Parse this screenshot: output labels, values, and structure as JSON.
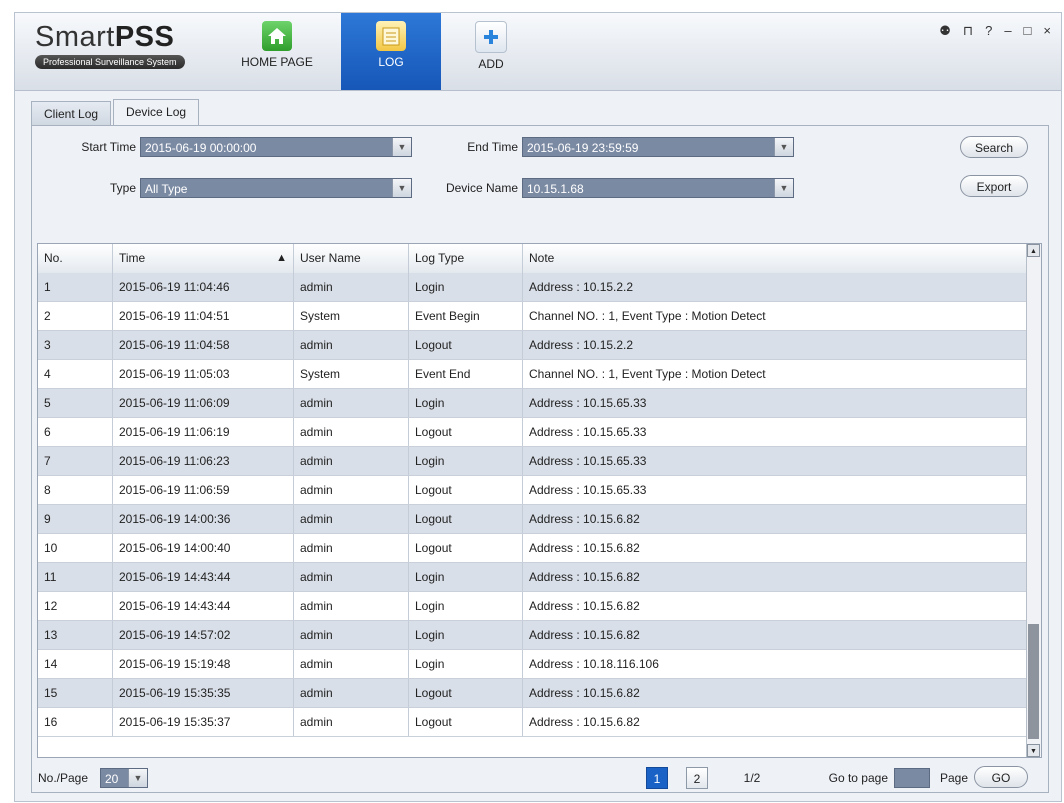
{
  "app": {
    "title_light": "Smart",
    "title_bold": "PSS",
    "subtitle": "Professional Surveillance System"
  },
  "nav": {
    "home": "HOME PAGE",
    "log": "LOG",
    "add": "ADD"
  },
  "window_controls": {
    "user": "⚉",
    "lock": "⊓",
    "help": "?",
    "minimize": "–",
    "maximize": "□",
    "close": "×"
  },
  "tabs": [
    "Client Log",
    "Device Log"
  ],
  "filters": {
    "start_label": "Start Time",
    "start_value": "2015-06-19 00:00:00",
    "end_label": "End Time",
    "end_value": "2015-06-19 23:59:59",
    "type_label": "Type",
    "type_value": "All Type",
    "device_label": "Device Name",
    "device_value": "10.15.1.68",
    "search": "Search",
    "export": "Export"
  },
  "table": {
    "headers": [
      "No.",
      "Time",
      "User Name",
      "Log Type",
      "Note"
    ],
    "rows": [
      [
        "1",
        "2015-06-19 11:04:46",
        "admin",
        "Login",
        "Address : 10.15.2.2"
      ],
      [
        "2",
        "2015-06-19 11:04:51",
        "System",
        "Event Begin",
        "Channel NO. : 1, Event Type : Motion Detect"
      ],
      [
        "3",
        "2015-06-19 11:04:58",
        "admin",
        "Logout",
        "Address : 10.15.2.2"
      ],
      [
        "4",
        "2015-06-19 11:05:03",
        "System",
        "Event End",
        "Channel NO. : 1, Event Type : Motion Detect"
      ],
      [
        "5",
        "2015-06-19 11:06:09",
        "admin",
        "Login",
        "Address : 10.15.65.33"
      ],
      [
        "6",
        "2015-06-19 11:06:19",
        "admin",
        "Logout",
        "Address : 10.15.65.33"
      ],
      [
        "7",
        "2015-06-19 11:06:23",
        "admin",
        "Login",
        "Address : 10.15.65.33"
      ],
      [
        "8",
        "2015-06-19 11:06:59",
        "admin",
        "Logout",
        "Address : 10.15.65.33"
      ],
      [
        "9",
        "2015-06-19 14:00:36",
        "admin",
        "Logout",
        "Address : 10.15.6.82"
      ],
      [
        "10",
        "2015-06-19 14:00:40",
        "admin",
        "Logout",
        "Address : 10.15.6.82"
      ],
      [
        "11",
        "2015-06-19 14:43:44",
        "admin",
        "Login",
        "Address : 10.15.6.82"
      ],
      [
        "12",
        "2015-06-19 14:43:44",
        "admin",
        "Login",
        "Address : 10.15.6.82"
      ],
      [
        "13",
        "2015-06-19 14:57:02",
        "admin",
        "Login",
        "Address : 10.15.6.82"
      ],
      [
        "14",
        "2015-06-19 15:19:48",
        "admin",
        "Login",
        "Address : 10.18.116.106"
      ],
      [
        "15",
        "2015-06-19 15:35:35",
        "admin",
        "Logout",
        "Address : 10.15.6.82"
      ],
      [
        "16",
        "2015-06-19 15:35:37",
        "admin",
        "Logout",
        "Address : 10.15.6.82"
      ]
    ]
  },
  "footer": {
    "per_page_label": "No./Page",
    "per_page_value": "20",
    "page1": "1",
    "page2": "2",
    "page_count": "1/2",
    "goto_label": "Go to page",
    "goto_value": "",
    "page_label": "Page",
    "go": "GO"
  },
  "colors": {
    "accent": "#1a62c6",
    "row_alt": "#d9dfe8",
    "combo": "#7b8aa3"
  }
}
